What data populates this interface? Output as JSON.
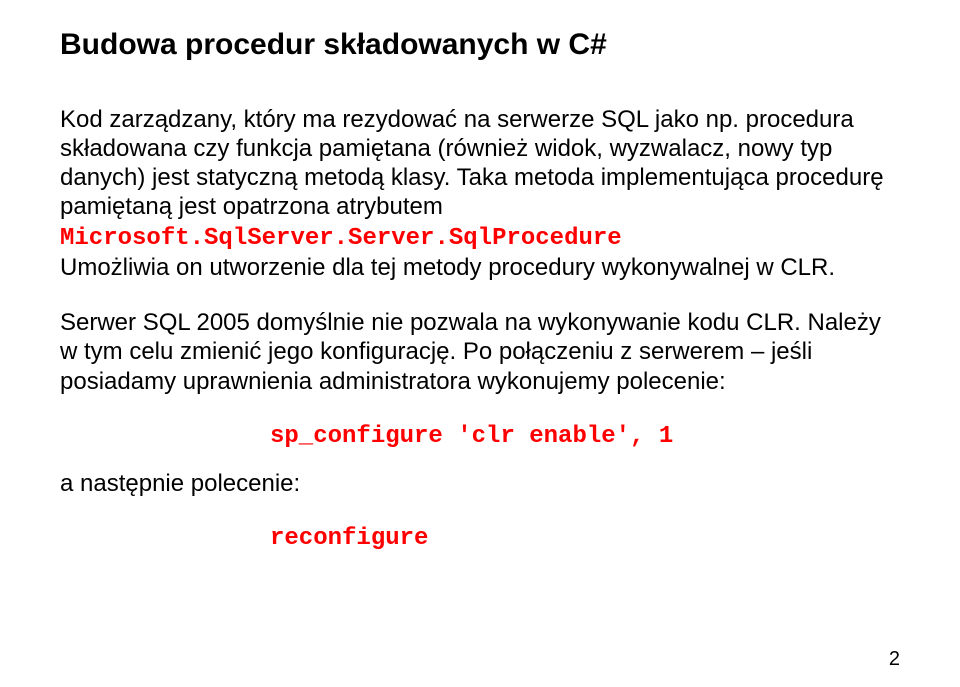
{
  "title": "Budowa procedur składowanych w C#",
  "para1_a": "Kod zarządzany, który ma rezydować na serwerze SQL jako np. procedura składowana czy funkcja pamiętana (również widok, wyzwalacz, nowy typ danych) jest statyczną metodą klasy. Taka metoda implementująca procedurę pamiętaną jest  opatrzona atrybutem ",
  "code1": "Microsoft.SqlServer.Server.SqlProcedure",
  "para1_b": "Umożliwia on utworzenie dla tej metody procedury wykonywalnej w CLR.",
  "para2": "Serwer SQL 2005 domyślnie nie pozwala na wykonywanie kodu CLR. Należy w tym celu zmienić jego  konfigurację. Po połączeniu z serwerem – jeśli posiadamy uprawnienia administratora wykonujemy polecenie:",
  "codeblock1": "sp_configure 'clr enable', 1",
  "para3": "a następnie polecenie:",
  "codeblock2": "reconfigure",
  "page_number": "2"
}
